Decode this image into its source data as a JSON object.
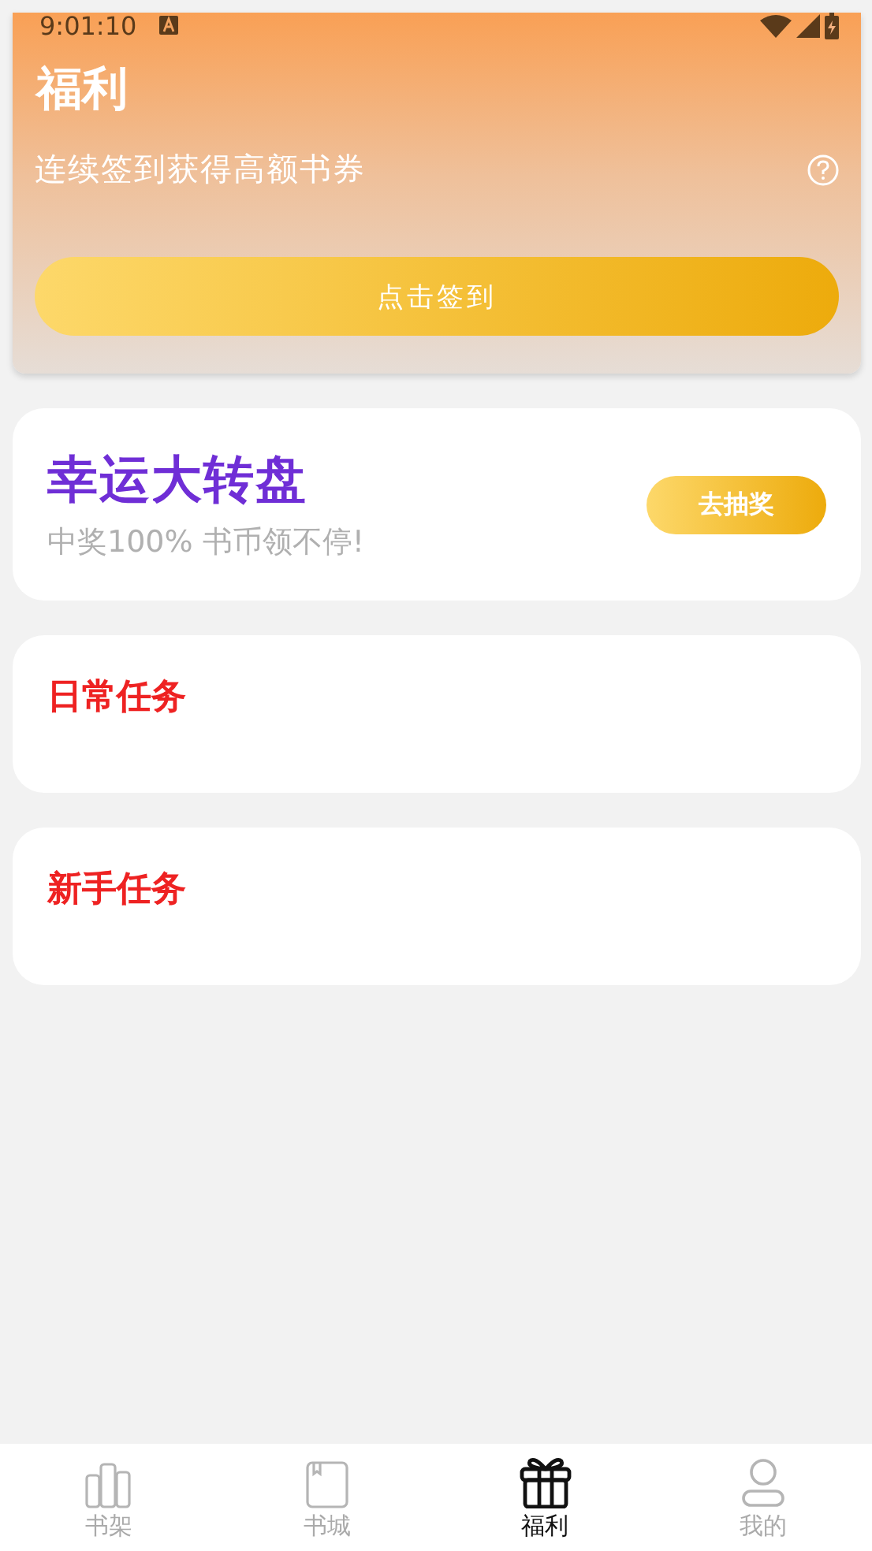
{
  "status_bar": {
    "time": "9:01:10"
  },
  "header": {
    "title": "福利",
    "subtitle": "连续签到获得高额书券",
    "sign_button": "点击签到"
  },
  "lucky_wheel": {
    "title": "幸运大转盘",
    "subtitle": "中奖100% 书币领不停!",
    "button": "去抽奖"
  },
  "sections": [
    {
      "title": "日常任务"
    },
    {
      "title": "新手任务"
    }
  ],
  "tab_bar": [
    {
      "kind": "shelf",
      "label": "书架",
      "selected": false
    },
    {
      "kind": "store",
      "label": "书城",
      "selected": false
    },
    {
      "kind": "gift",
      "label": "福利",
      "selected": true
    },
    {
      "kind": "profile",
      "label": "我的",
      "selected": false
    }
  ]
}
